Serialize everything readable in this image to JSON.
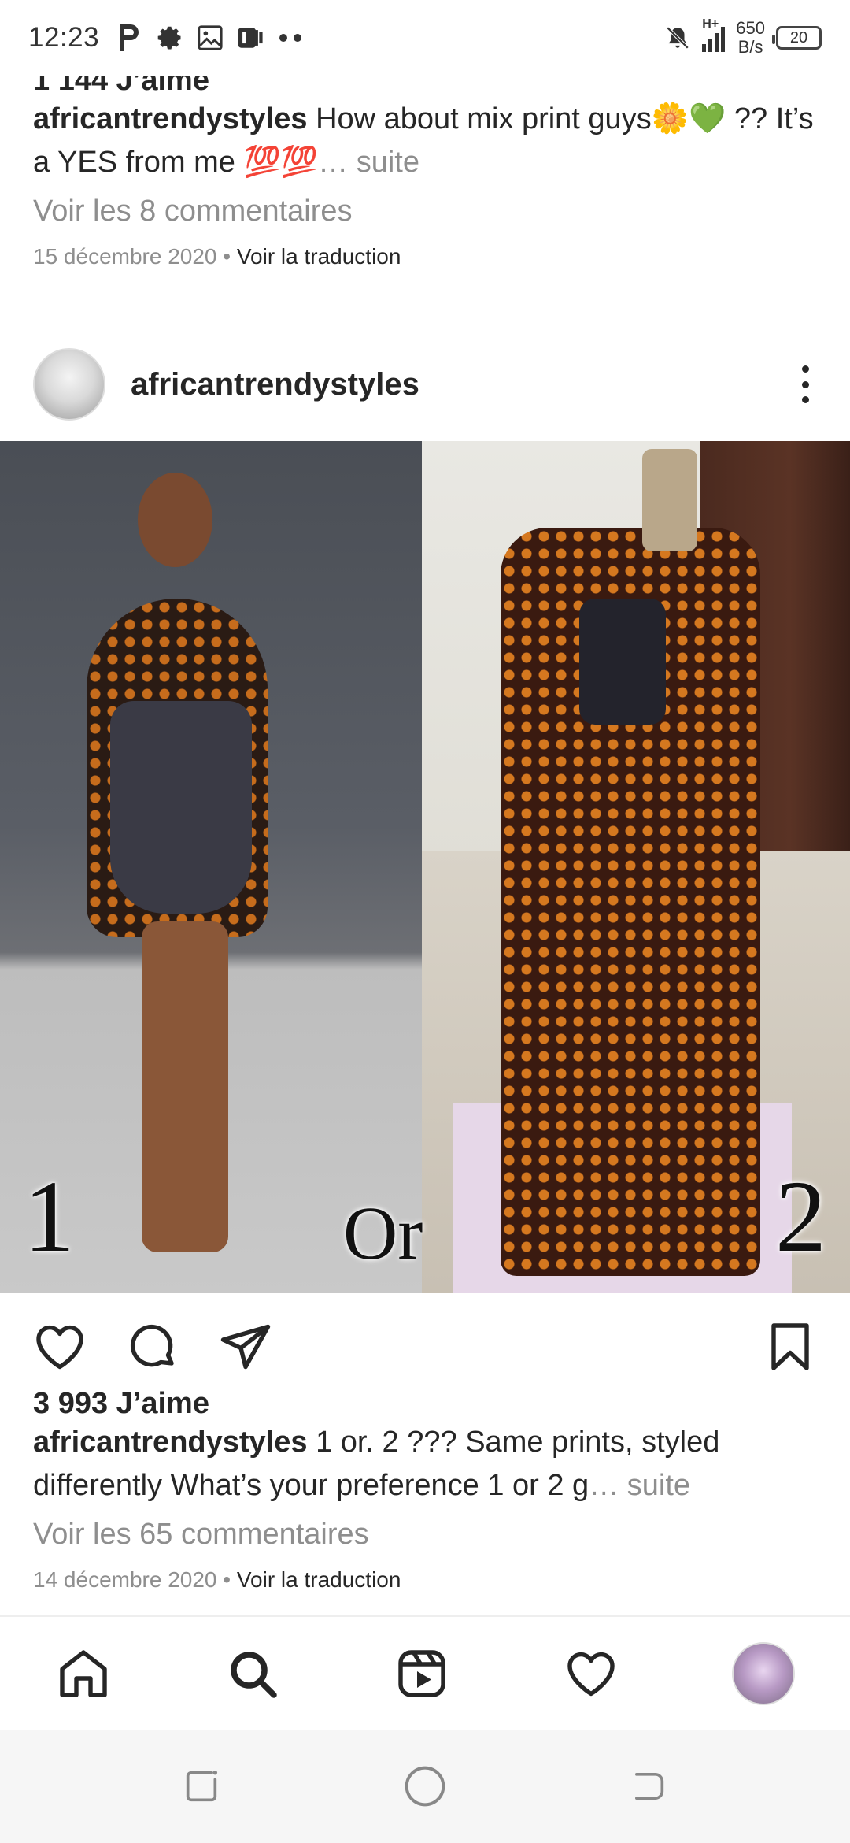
{
  "status_bar": {
    "time": "12:23",
    "network_speed_value": "650",
    "network_speed_unit": "B/s",
    "network_type": "H+",
    "battery_level": "20",
    "icons": [
      "parking-icon",
      "settings-icon",
      "gallery-icon",
      "app-icon",
      "more-dots-icon",
      "mute-icon",
      "signal-icon",
      "battery-icon"
    ]
  },
  "post1": {
    "likes": "1 144 J’aime",
    "username": "africantrendystyles",
    "caption": "How about mix print  guys🌼💚 ?? It’s a YES from me 💯💯",
    "more": "… suite",
    "comments_link": "Voir les 8 commentaires",
    "date": "15 décembre 2020",
    "translate": "Voir la traduction"
  },
  "post2": {
    "header": {
      "username": "africantrendystyles"
    },
    "image_labels": {
      "left": "1",
      "middle": "Or",
      "right": "2"
    },
    "likes": "3 993 J’aime",
    "username": "africantrendystyles",
    "caption": "1  or. 2 ??? Same prints, styled differently What’s your preference 1 or  2 g",
    "more": "… suite",
    "comments_link": "Voir les 65 commentaires",
    "date": "14 décembre 2020",
    "translate": "Voir la traduction"
  },
  "colors": {
    "text": "#262626",
    "muted": "#8e8e8e"
  }
}
